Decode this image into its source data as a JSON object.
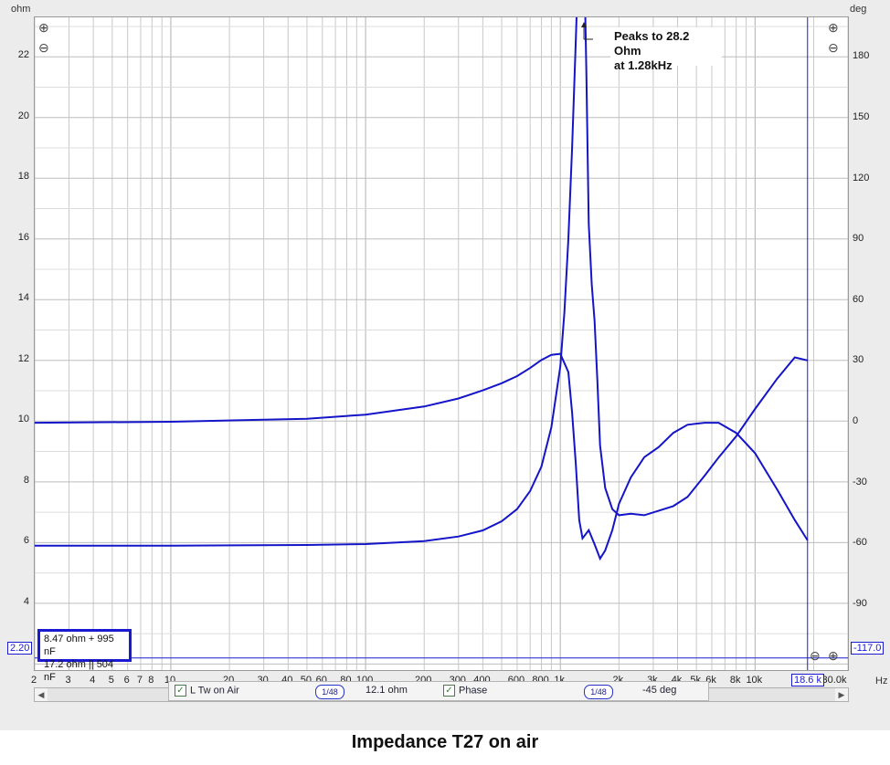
{
  "axes": {
    "left_unit": "ohm",
    "right_unit": "deg",
    "x_unit": "Hz",
    "left_ticks": [
      "22",
      "20",
      "18",
      "16",
      "14",
      "12",
      "10",
      "8",
      "6",
      "4"
    ],
    "right_ticks": [
      "180",
      "150",
      "120",
      "90",
      "60",
      "30",
      "0",
      "-30",
      "-60",
      "-90"
    ],
    "x_ticks": [
      "2",
      "3",
      "4",
      "5",
      "6",
      "7",
      "8",
      "10",
      "20",
      "30",
      "40",
      "50",
      "60",
      "80",
      "100",
      "200",
      "300",
      "400",
      "600",
      "800",
      "1k",
      "2k",
      "3k",
      "4k",
      "5k",
      "6k",
      "8k",
      "10k",
      "30.0k"
    ]
  },
  "cursor": {
    "left_value": "2.20",
    "right_value": "-117.0",
    "x_value": "18.6 k"
  },
  "fit_box": {
    "line1": "8.47 ohm + 995 nF",
    "line2": "17.2 ohm || 504 nF"
  },
  "annotation": {
    "line1": "Peaks to 28.2 Ohm",
    "line2": "at 1.28kHz"
  },
  "legend": {
    "trace1_label": "L Tw on Air",
    "trace1_smoothing": "1/48",
    "trace1_value": "12.1 ohm",
    "trace2_label": "Phase",
    "trace2_smoothing": "1/48",
    "trace2_value": "-45 deg"
  },
  "caption": "Impedance T27 on air",
  "colors": {
    "trace": "#1414c8",
    "grid": "#c8c8c8",
    "cursor": "#1a1ad0"
  },
  "chart_data": {
    "type": "line",
    "title": "Impedance T27 on air",
    "xlabel": "Hz",
    "ylabel": "ohm",
    "y2label": "deg",
    "xscale": "log",
    "xlim": [
      2,
      30000
    ],
    "ylim": [
      1.8,
      23.3
    ],
    "y2lim": [
      -122,
      200
    ],
    "grid": true,
    "series": [
      {
        "name": "L Tw on Air",
        "axis": "left",
        "x": [
          2,
          10,
          50,
          100,
          200,
          300,
          400,
          500,
          600,
          700,
          800,
          900,
          1000,
          1050,
          1100,
          1150,
          1200,
          1250,
          1280,
          1320,
          1360,
          1400,
          1450,
          1500,
          1550,
          1600,
          1700,
          1850,
          2000,
          2300,
          2700,
          3200,
          3800,
          4500,
          5500,
          6500,
          8000,
          10000,
          13000,
          16000,
          18600
        ],
        "y": [
          5.9,
          5.9,
          5.92,
          5.95,
          6.05,
          6.2,
          6.4,
          6.7,
          7.1,
          7.7,
          8.5,
          9.8,
          11.8,
          13.6,
          16.0,
          19.0,
          22.5,
          26.0,
          28.2,
          26.0,
          21.5,
          16.5,
          14.5,
          13.3,
          11.3,
          9.2,
          7.8,
          7.1,
          6.9,
          6.95,
          6.9,
          7.05,
          7.2,
          7.5,
          8.2,
          8.8,
          9.5,
          10.4,
          11.4,
          12.1,
          12.0
        ]
      },
      {
        "name": "Phase",
        "axis": "right",
        "x": [
          2,
          10,
          50,
          100,
          200,
          300,
          400,
          500,
          600,
          700,
          800,
          900,
          1000,
          1100,
          1150,
          1200,
          1250,
          1300,
          1400,
          1500,
          1600,
          1700,
          1850,
          2000,
          2300,
          2700,
          3200,
          3800,
          4500,
          5500,
          6500,
          8000,
          10000,
          13000,
          16000,
          18600
        ],
        "y": [
          0,
          0.5,
          2,
          4,
          8,
          12,
          16,
          19.5,
          23,
          27,
          31,
          33.5,
          34,
          25,
          5,
          -20,
          -48,
          -57,
          -53,
          -60,
          -67,
          -63,
          -53,
          -40,
          -27,
          -17,
          -12,
          -5,
          -1,
          0,
          0,
          -5,
          -15,
          -33,
          -48,
          -58
        ]
      }
    ]
  }
}
